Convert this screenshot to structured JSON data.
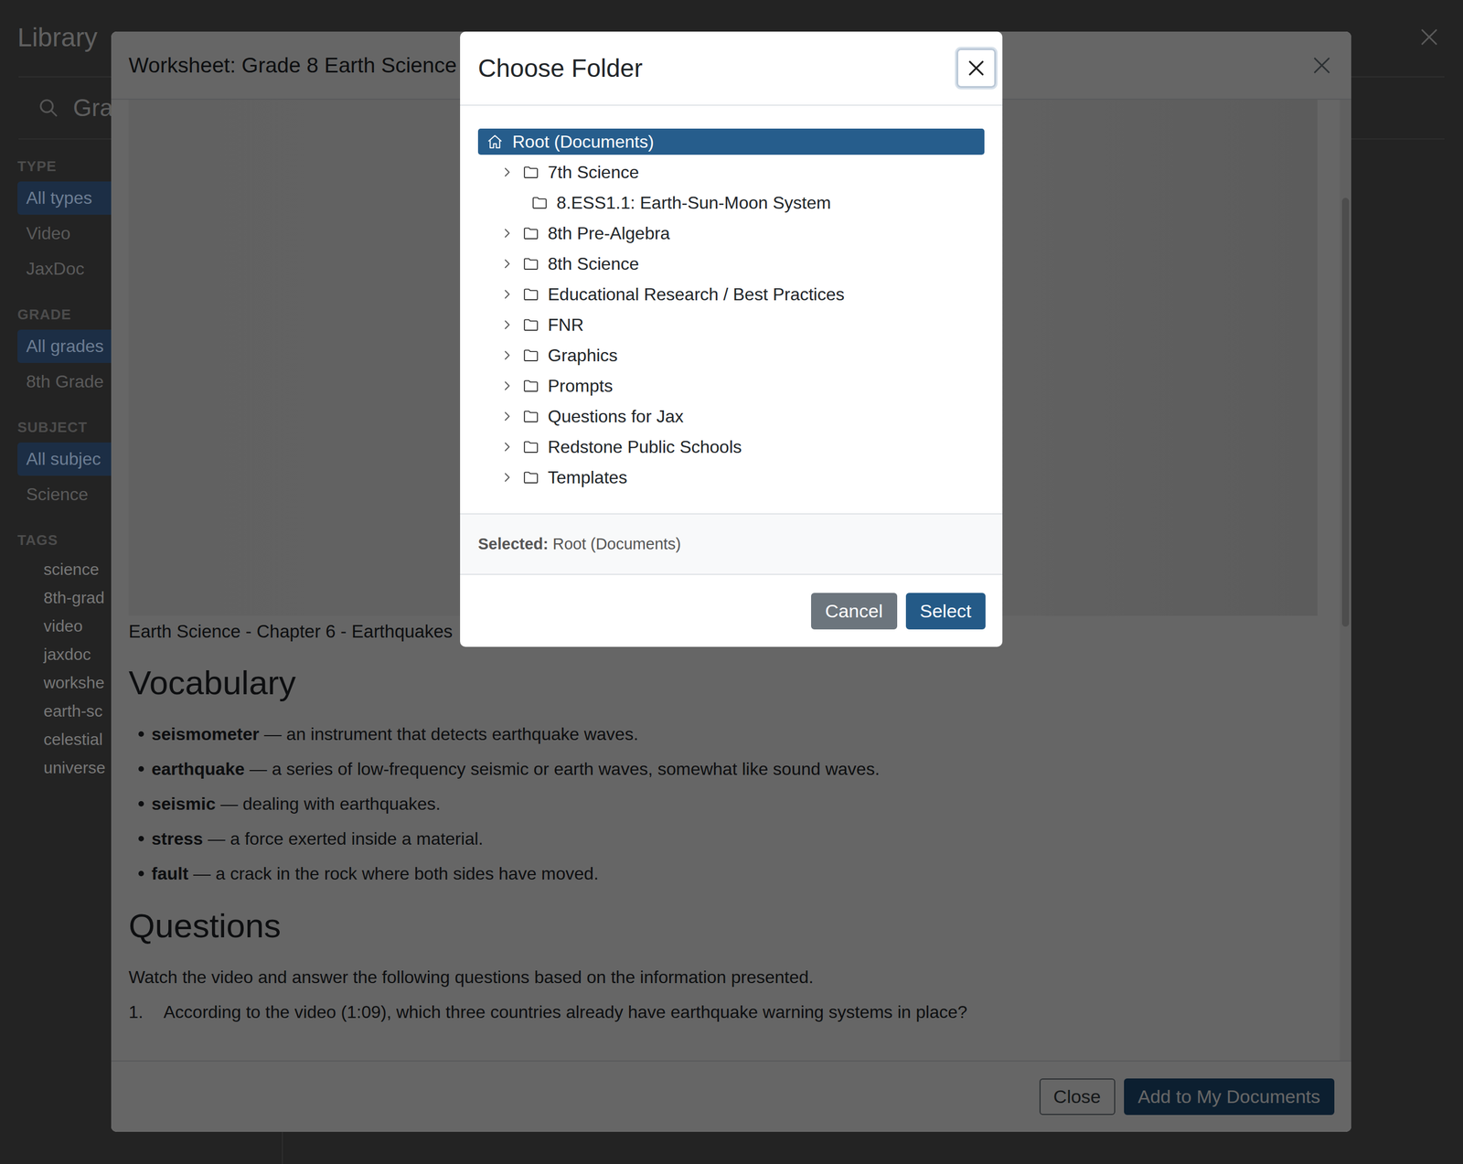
{
  "library": {
    "title": "Library",
    "search": {
      "value": "Grad"
    },
    "filters": [
      {
        "heading": "TYPE",
        "options": [
          {
            "label": "All types",
            "selected": true
          },
          {
            "label": "Video",
            "selected": false
          },
          {
            "label": "JaxDoc",
            "selected": false
          }
        ]
      },
      {
        "heading": "GRADE",
        "options": [
          {
            "label": "All grades",
            "selected": true
          },
          {
            "label": "8th Grade",
            "selected": false
          }
        ]
      },
      {
        "heading": "SUBJECT",
        "options": [
          {
            "label": "All subjec",
            "selected": true
          },
          {
            "label": "Science",
            "selected": false
          }
        ]
      }
    ],
    "tags": {
      "heading": "TAGS",
      "items": [
        "science",
        "8th-grad",
        "video",
        "jaxdoc",
        "workshe",
        "earth-sc",
        "celestial",
        "universe"
      ]
    }
  },
  "worksheet": {
    "title": "Worksheet: Grade 8 Earth Science",
    "caption": "Earth Science - Chapter 6 - Earthquakes",
    "vocabulary": {
      "heading": "Vocabulary",
      "items": [
        {
          "term": "seismometer",
          "definition": "— an instrument that detects earthquake waves."
        },
        {
          "term": "earthquake",
          "definition": "— a series of low-frequency seismic or earth waves, somewhat like sound waves."
        },
        {
          "term": "seismic",
          "definition": "— dealing with earthquakes."
        },
        {
          "term": "stress",
          "definition": "— a force exerted inside a material."
        },
        {
          "term": "fault",
          "definition": "— a crack in the rock where both sides have moved."
        }
      ]
    },
    "questions": {
      "heading": "Questions",
      "intro": "Watch the video and answer the following questions based on the information presented.",
      "items": [
        {
          "number": "1.",
          "text": "According to the video (1:09), which three countries already have earthquake warning systems in place?"
        }
      ]
    },
    "buttons": [
      "Close",
      "Add to My Documents"
    ]
  },
  "dialog": {
    "title": "Choose Folder",
    "tree": [
      {
        "label": "Root (Documents)",
        "kind": "root",
        "expandable": false,
        "selected": true
      },
      {
        "label": "7th Science",
        "kind": "folder",
        "expandable": true,
        "selected": false
      },
      {
        "label": "8.ESS1.1: Earth-Sun-Moon System",
        "kind": "folder",
        "expandable": false,
        "selected": false
      },
      {
        "label": "8th Pre-Algebra",
        "kind": "folder",
        "expandable": true,
        "selected": false
      },
      {
        "label": "8th Science",
        "kind": "folder",
        "expandable": true,
        "selected": false
      },
      {
        "label": "Educational Research / Best Practices",
        "kind": "folder",
        "expandable": true,
        "selected": false
      },
      {
        "label": "FNR",
        "kind": "folder",
        "expandable": true,
        "selected": false
      },
      {
        "label": "Graphics",
        "kind": "folder",
        "expandable": true,
        "selected": false
      },
      {
        "label": "Prompts",
        "kind": "folder",
        "expandable": true,
        "selected": false
      },
      {
        "label": "Questions for Jax",
        "kind": "folder",
        "expandable": true,
        "selected": false
      },
      {
        "label": "Redstone Public Schools",
        "kind": "folder",
        "expandable": true,
        "selected": false
      },
      {
        "label": "Templates",
        "kind": "folder",
        "expandable": true,
        "selected": false
      }
    ],
    "selected_label": "Selected:",
    "selected_value": "Root (Documents)",
    "buttons": [
      "Cancel",
      "Select"
    ]
  }
}
